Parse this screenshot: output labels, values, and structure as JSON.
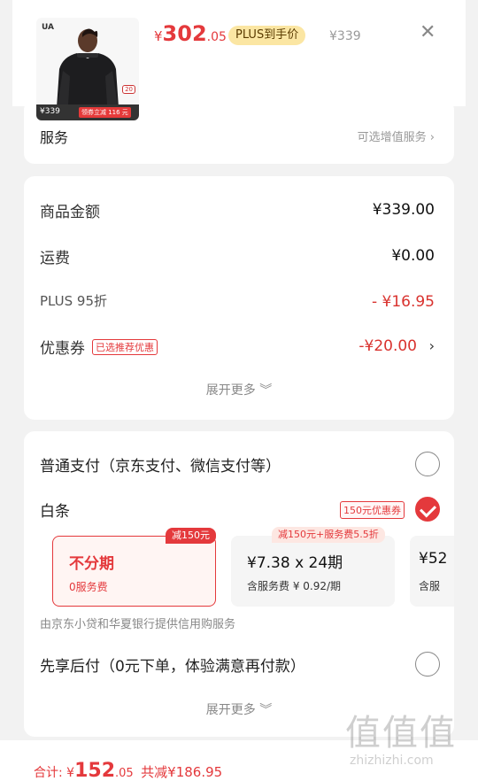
{
  "header": {
    "price_yen": "¥",
    "price_int": "302",
    "price_dec": ".05",
    "plus_tag": "PLUS到手价",
    "original_price": "¥339",
    "close_icon": "close-icon",
    "thumb": {
      "brand": "UA",
      "badge": "20",
      "strip_price": "¥339",
      "strip_promo": "领券立减 116 元"
    }
  },
  "service": {
    "label": "服务",
    "value": "可选增值服务 ›"
  },
  "summary": {
    "rows": [
      {
        "label": "商品金额",
        "value": "¥339.00"
      },
      {
        "label": "运费",
        "value": "¥0.00"
      },
      {
        "label": "PLUS 95折",
        "value": "- ¥16.95"
      },
      {
        "label": "优惠券",
        "tag": "已选推荐优惠",
        "value": "-¥20.00",
        "chevron": "›"
      }
    ],
    "expand": "展开更多 ︾"
  },
  "payment": {
    "normal_label": "普通支付（京东支付、微信支付等）",
    "baitiao_label": "白条",
    "baitiao_coupon": "150元优惠券",
    "plans": [
      {
        "badge": "减150元",
        "title": "不分期",
        "sub": "0服务费"
      },
      {
        "badge": "减150元+服务费5.5折",
        "title": "¥7.38 x 24期",
        "sub": "含服务费 ¥ 0.92/期"
      },
      {
        "title": "¥52",
        "sub": "含服"
      }
    ],
    "note": "由京东小贷和华夏银行提供信用购服务",
    "later_label": "先享后付（0元下单，体验满意再付款）",
    "expand": "展开更多 ︾"
  },
  "footer": {
    "total_label": "合计: ¥",
    "total_int": "152",
    "total_dec": ".05",
    "saved": "共减¥186.95"
  },
  "watermark": {
    "chars": "值值值",
    "url": "zhizhizhi.com"
  },
  "colors": {
    "accent": "#e4393c",
    "plus_bg": "#fbe6a3"
  }
}
